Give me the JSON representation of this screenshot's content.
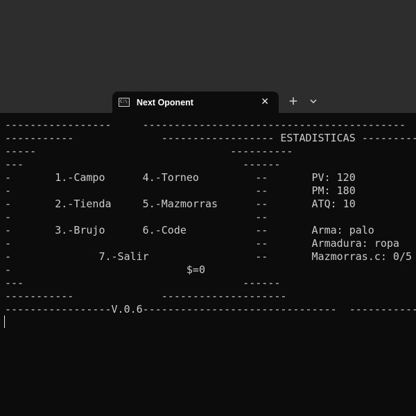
{
  "tab": {
    "title": "Next Oponent",
    "icon": "terminal-icon",
    "close_glyph": "✕"
  },
  "toolbar": {
    "new_tab_glyph": "+",
    "dropdown_icon": "chevron-down-icon"
  },
  "console": {
    "lines": [
      "-----------------     ------------------------------------------",
      "-----------              ------------------ ESTADISTICAS ---------",
      "-----                               ----------",
      "---                                   ------",
      "-       1.-Campo      4.-Torneo         --       PV: 120",
      "-                                       --       PM: 180",
      "-       2.-Tienda     5.-Mazmorras      --       ATQ: 10",
      "-                                       --",
      "-       3.-Brujo      6.-Code           --       Arma: palo",
      "-                                       --       Armadura: ropa",
      "-              7.-Salir                 --       Mazmorras.c: 0/5",
      "-                            $=0",
      "---                                   ------",
      "-----------              --------------------",
      "-----------------V.0.6-------------------------------  -------------"
    ]
  },
  "colors": {
    "titlebar_bg": "#2d2d2d",
    "console_bg": "#0c0c0c",
    "console_text": "#cccccc"
  }
}
